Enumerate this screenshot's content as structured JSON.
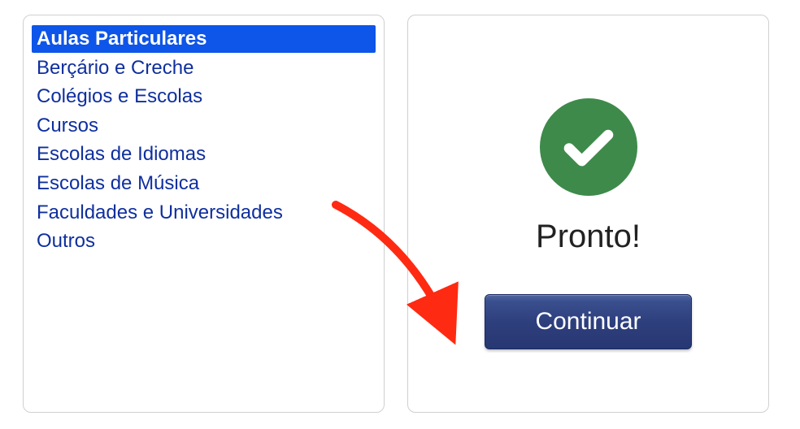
{
  "categories": {
    "items": [
      {
        "label": "Aulas Particulares",
        "selected": true
      },
      {
        "label": "Berçário e Creche",
        "selected": false
      },
      {
        "label": "Colégios e Escolas",
        "selected": false
      },
      {
        "label": "Cursos",
        "selected": false
      },
      {
        "label": "Escolas de Idiomas",
        "selected": false
      },
      {
        "label": "Escolas de Música",
        "selected": false
      },
      {
        "label": "Faculdades e Universidades",
        "selected": false
      },
      {
        "label": "Outros",
        "selected": false
      }
    ]
  },
  "status": {
    "ready_label": "Pronto!",
    "icon_name": "check-icon",
    "icon_color": "#3e8a4b"
  },
  "actions": {
    "continue_label": "Continuar"
  },
  "annotation": {
    "arrow_color": "#ff2a12"
  }
}
